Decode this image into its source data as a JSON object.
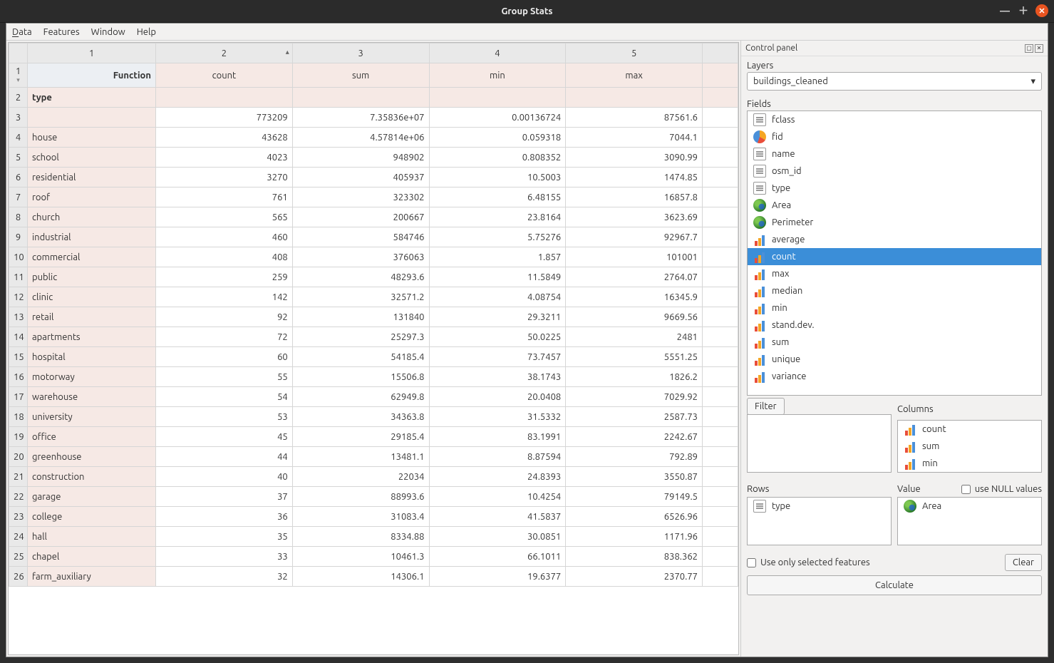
{
  "window": {
    "title": "Group Stats"
  },
  "menu": {
    "data": "Data",
    "features": "Features",
    "window": "Window",
    "help": "Help"
  },
  "table": {
    "corner": "1",
    "col_labels": [
      "1",
      "2",
      "3",
      "4",
      "5"
    ],
    "functions_label": "Function",
    "type_label": "type",
    "headers": [
      "count",
      "sum",
      "min",
      "max"
    ],
    "rows": [
      {
        "n": 3,
        "type": "",
        "count": "773209",
        "sum": "7.35836e+07",
        "min": "0.00136724",
        "max": "87561.6"
      },
      {
        "n": 4,
        "type": "house",
        "count": "43628",
        "sum": "4.57814e+06",
        "min": "0.059318",
        "max": "7044.1"
      },
      {
        "n": 5,
        "type": "school",
        "count": "4023",
        "sum": "948902",
        "min": "0.808352",
        "max": "3090.99"
      },
      {
        "n": 6,
        "type": "residential",
        "count": "3270",
        "sum": "405937",
        "min": "10.5003",
        "max": "1474.85"
      },
      {
        "n": 7,
        "type": "roof",
        "count": "761",
        "sum": "323302",
        "min": "6.48155",
        "max": "16857.8"
      },
      {
        "n": 8,
        "type": "church",
        "count": "565",
        "sum": "200667",
        "min": "23.8164",
        "max": "3623.69"
      },
      {
        "n": 9,
        "type": "industrial",
        "count": "460",
        "sum": "584746",
        "min": "5.75276",
        "max": "92967.7"
      },
      {
        "n": 10,
        "type": "commercial",
        "count": "408",
        "sum": "376063",
        "min": "1.857",
        "max": "101001"
      },
      {
        "n": 11,
        "type": "public",
        "count": "259",
        "sum": "48293.6",
        "min": "11.5849",
        "max": "2764.07"
      },
      {
        "n": 12,
        "type": "clinic",
        "count": "142",
        "sum": "32571.2",
        "min": "4.08754",
        "max": "16345.9"
      },
      {
        "n": 13,
        "type": "retail",
        "count": "92",
        "sum": "131840",
        "min": "29.3211",
        "max": "9669.56"
      },
      {
        "n": 14,
        "type": "apartments",
        "count": "72",
        "sum": "25297.3",
        "min": "50.0225",
        "max": "2481"
      },
      {
        "n": 15,
        "type": "hospital",
        "count": "60",
        "sum": "54185.4",
        "min": "73.7457",
        "max": "5551.25"
      },
      {
        "n": 16,
        "type": "motorway",
        "count": "55",
        "sum": "15506.8",
        "min": "38.1743",
        "max": "1826.2"
      },
      {
        "n": 17,
        "type": "warehouse",
        "count": "54",
        "sum": "62949.8",
        "min": "20.0408",
        "max": "7029.92"
      },
      {
        "n": 18,
        "type": "university",
        "count": "53",
        "sum": "34363.8",
        "min": "31.5332",
        "max": "2587.73"
      },
      {
        "n": 19,
        "type": "office",
        "count": "45",
        "sum": "29185.4",
        "min": "83.1991",
        "max": "2242.67"
      },
      {
        "n": 20,
        "type": "greenhouse",
        "count": "44",
        "sum": "13481.1",
        "min": "8.87594",
        "max": "792.89"
      },
      {
        "n": 21,
        "type": "construction",
        "count": "40",
        "sum": "22034",
        "min": "24.8393",
        "max": "3550.87"
      },
      {
        "n": 22,
        "type": "garage",
        "count": "37",
        "sum": "88993.6",
        "min": "10.4254",
        "max": "79149.5"
      },
      {
        "n": 23,
        "type": "college",
        "count": "36",
        "sum": "31083.4",
        "min": "41.5837",
        "max": "6526.96"
      },
      {
        "n": 24,
        "type": "hall",
        "count": "35",
        "sum": "8334.88",
        "min": "30.0851",
        "max": "1171.96"
      },
      {
        "n": 25,
        "type": "chapel",
        "count": "33",
        "sum": "10461.3",
        "min": "66.1011",
        "max": "838.362"
      },
      {
        "n": 26,
        "type": "farm_auxiliary",
        "count": "32",
        "sum": "14306.1",
        "min": "19.6377",
        "max": "2370.77"
      }
    ]
  },
  "panel": {
    "title": "Control panel",
    "layers_label": "Layers",
    "layer_value": "buildings_cleaned",
    "fields_label": "Fields",
    "fields": [
      {
        "icon": "text",
        "label": "fclass"
      },
      {
        "icon": "pie",
        "label": "fid"
      },
      {
        "icon": "text",
        "label": "name"
      },
      {
        "icon": "text",
        "label": "osm_id"
      },
      {
        "icon": "text",
        "label": "type"
      },
      {
        "icon": "globe",
        "label": "Area"
      },
      {
        "icon": "globe",
        "label": "Perimeter"
      },
      {
        "icon": "stat",
        "label": "average"
      },
      {
        "icon": "stat",
        "label": "count",
        "selected": true
      },
      {
        "icon": "stat",
        "label": "max"
      },
      {
        "icon": "stat",
        "label": "median"
      },
      {
        "icon": "stat",
        "label": "min"
      },
      {
        "icon": "stat",
        "label": "stand.dev."
      },
      {
        "icon": "stat",
        "label": "sum"
      },
      {
        "icon": "stat",
        "label": "unique"
      },
      {
        "icon": "stat",
        "label": "variance"
      }
    ],
    "filter_label": "Filter",
    "columns_label": "Columns",
    "columns": [
      {
        "icon": "stat",
        "label": "count"
      },
      {
        "icon": "stat",
        "label": "sum"
      },
      {
        "icon": "stat",
        "label": "min"
      }
    ],
    "rows_label": "Rows",
    "value_label": "Value",
    "null_label": "use NULL values",
    "null_checked": false,
    "rows_items": [
      {
        "icon": "text",
        "label": "type"
      }
    ],
    "value_items": [
      {
        "icon": "globe",
        "label": "Area"
      }
    ],
    "use_selected_label": "Use only selected features",
    "use_selected_checked": false,
    "clear_label": "Clear",
    "calculate_label": "Calculate"
  }
}
